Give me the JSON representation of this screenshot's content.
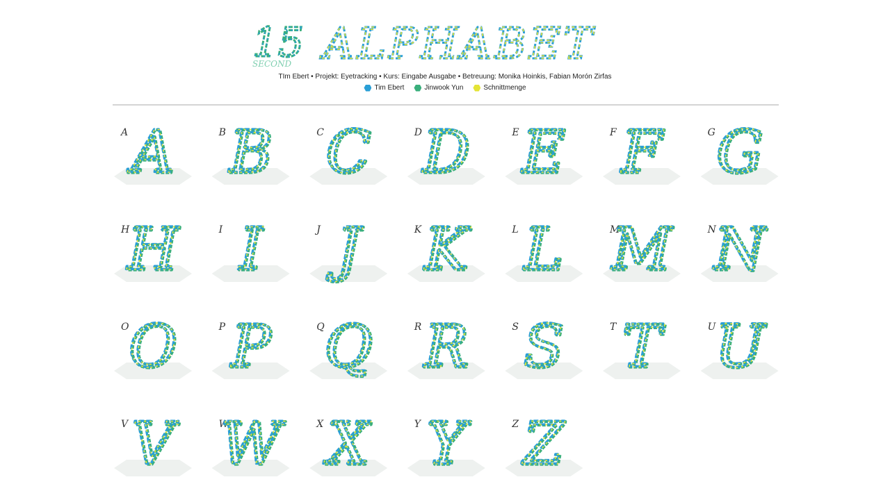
{
  "header": {
    "title": "15 SECOND ALPHABET",
    "title_number": "15",
    "title_word": "ALPHABET",
    "title_sub": "SECOND",
    "credits": "TIm Ebert • Projekt: Eyetracking • Kurs: Eingabe Ausgabe • Betreuung: Monika Hoinkis, Fabian Morón Zirfas"
  },
  "legend": [
    {
      "label": "Tim Ebert",
      "color": "#2a9fd6"
    },
    {
      "label": "Jinwook Yun",
      "color": "#3aaf7c"
    },
    {
      "label": "Schnittmenge",
      "color": "#e4e436"
    }
  ],
  "colors": {
    "tim": "#2a9fd6",
    "jinwook": "#3aaf7c",
    "overlap": "#e4e436",
    "base": "#eef1ef",
    "divider": "#d4d4d4"
  },
  "letters": [
    "A",
    "B",
    "C",
    "D",
    "E",
    "F",
    "G",
    "H",
    "I",
    "J",
    "K",
    "L",
    "M",
    "N",
    "O",
    "P",
    "Q",
    "R",
    "S",
    "T",
    "U",
    "V",
    "W",
    "X",
    "Y",
    "Z"
  ]
}
